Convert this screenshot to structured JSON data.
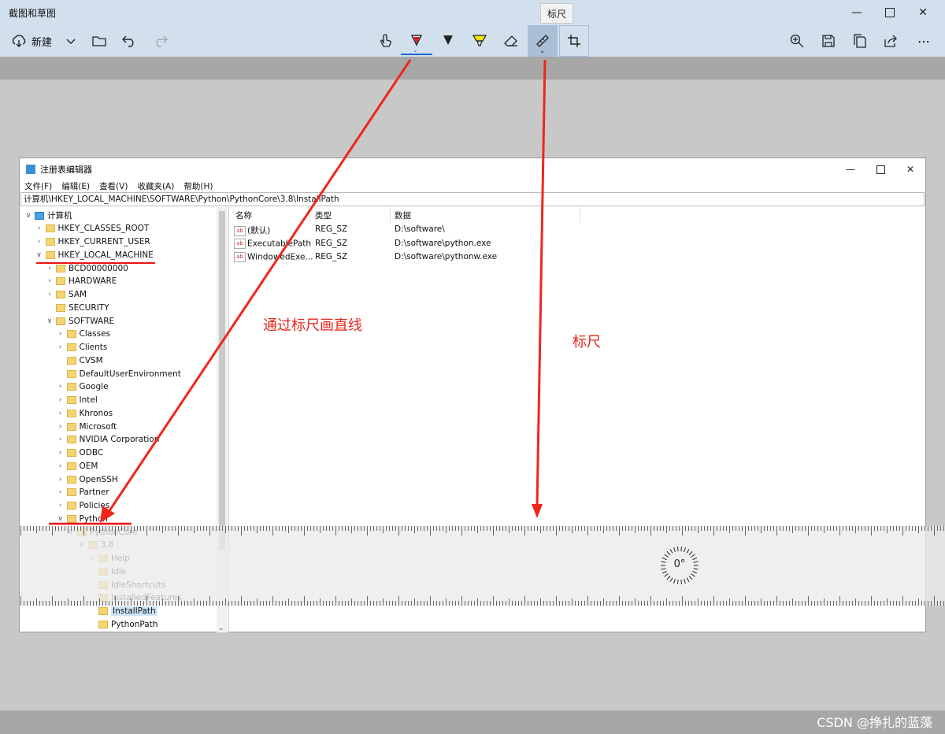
{
  "app": {
    "title": "截图和草图"
  },
  "toolbar": {
    "new_label": "新建",
    "tooltip": "标尺"
  },
  "colors": {
    "pen_red": "#e21b1b",
    "highlighter_yellow": "#f5e10c",
    "selected_underline": "#1b6ac9",
    "annotation_red": "#e8261c"
  },
  "icons": [
    "new-snip-icon",
    "chevron-down-icon",
    "folder-open-icon",
    "undo-icon",
    "redo-icon",
    "touch-writing-icon",
    "ballpoint-pen-icon",
    "pencil-icon",
    "highlighter-icon",
    "eraser-icon",
    "ruler-icon",
    "crop-icon",
    "zoom-icon",
    "save-icon",
    "copy-icon",
    "share-icon",
    "more-icon"
  ],
  "regedit": {
    "title": "注册表编辑器",
    "menu": [
      "文件(F)",
      "编辑(E)",
      "查看(V)",
      "收藏夹(A)",
      "帮助(H)"
    ],
    "address": "计算机\\HKEY_LOCAL_MACHINE\\SOFTWARE\\Python\\PythonCore\\3.8\\InstallPath",
    "tree": [
      {
        "label": "计算机",
        "level": 0,
        "state": "open"
      },
      {
        "label": "HKEY_CLASSES_ROOT",
        "level": 1,
        "state": "closed"
      },
      {
        "label": "HKEY_CURRENT_USER",
        "level": 1,
        "state": "closed"
      },
      {
        "label": "HKEY_LOCAL_MACHINE",
        "level": 1,
        "state": "open"
      },
      {
        "label": "BCD00000000",
        "level": 2,
        "state": "closed"
      },
      {
        "label": "HARDWARE",
        "level": 2,
        "state": "closed"
      },
      {
        "label": "SAM",
        "level": 2,
        "state": "closed"
      },
      {
        "label": "SECURITY",
        "level": 2,
        "state": "none"
      },
      {
        "label": "SOFTWARE",
        "level": 2,
        "state": "open"
      },
      {
        "label": "Classes",
        "level": 3,
        "state": "closed"
      },
      {
        "label": "Clients",
        "level": 3,
        "state": "closed"
      },
      {
        "label": "CVSM",
        "level": 3,
        "state": "none"
      },
      {
        "label": "DefaultUserEnvironment",
        "level": 3,
        "state": "none"
      },
      {
        "label": "Google",
        "level": 3,
        "state": "closed"
      },
      {
        "label": "Intel",
        "level": 3,
        "state": "closed"
      },
      {
        "label": "Khronos",
        "level": 3,
        "state": "closed"
      },
      {
        "label": "Microsoft",
        "level": 3,
        "state": "closed"
      },
      {
        "label": "NVIDIA Corporation",
        "level": 3,
        "state": "closed"
      },
      {
        "label": "ODBC",
        "level": 3,
        "state": "closed"
      },
      {
        "label": "OEM",
        "level": 3,
        "state": "closed"
      },
      {
        "label": "OpenSSH",
        "level": 3,
        "state": "closed"
      },
      {
        "label": "Partner",
        "level": 3,
        "state": "closed"
      },
      {
        "label": "Policies",
        "level": 3,
        "state": "closed"
      },
      {
        "label": "Python",
        "level": 3,
        "state": "open"
      },
      {
        "label": "PythonCore",
        "level": 4,
        "state": "open"
      },
      {
        "label": "3.8",
        "level": 5,
        "state": "open"
      },
      {
        "label": "Help",
        "level": 6,
        "state": "closed"
      },
      {
        "label": "Idle",
        "level": 6,
        "state": "none"
      },
      {
        "label": "IdleShortcuts",
        "level": 6,
        "state": "none"
      },
      {
        "label": "InstalledFeatures",
        "level": 6,
        "state": "none"
      },
      {
        "label": "InstallPath",
        "level": 6,
        "state": "none",
        "selected": true
      },
      {
        "label": "PythonPath",
        "level": 6,
        "state": "none"
      }
    ],
    "columns": [
      "名称",
      "类型",
      "数据"
    ],
    "values": [
      {
        "name": "(默认)",
        "type": "REG_SZ",
        "data": "D:\\software\\"
      },
      {
        "name": "ExecutablePath",
        "type": "REG_SZ",
        "data": "D:\\software\\python.exe"
      },
      {
        "name": "WindowedExe...",
        "type": "REG_SZ",
        "data": "D:\\software\\pythonw.exe"
      }
    ]
  },
  "ruler": {
    "angle": "0°"
  },
  "annotations": {
    "line_via_ruler": "通过标尺画直线",
    "ruler_label": "标尺"
  },
  "watermark": "CSDN @挣扎的蓝藻"
}
